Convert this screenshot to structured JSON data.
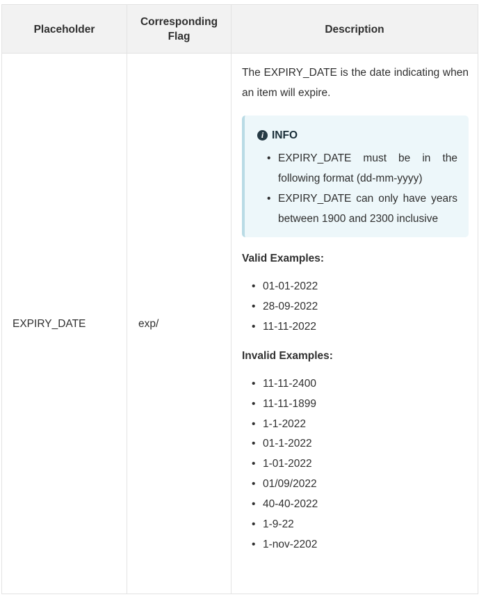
{
  "table": {
    "headers": {
      "placeholder": "Placeholder",
      "flag_line1": "Corresponding",
      "flag_line2": "Flag",
      "description": "Description"
    },
    "row": {
      "placeholder": "EXPIRY_DATE",
      "flag": "exp/",
      "description": {
        "intro": "The EXPIRY_DATE is the date indicating when an item will expire.",
        "info": {
          "icon": "info-circle-icon",
          "title": "INFO",
          "items": [
            "EXPIRY_DATE must be in the following format (dd-mm-yyyy)",
            "EXPIRY_DATE can only have years between 1900 and 2300 inclusive"
          ]
        },
        "valid_heading": "Valid Examples:",
        "valid_examples": [
          "01-01-2022",
          "28-09-2022",
          "11-11-2022"
        ],
        "invalid_heading": "Invalid Examples:",
        "invalid_examples": [
          "11-11-2400",
          "11-11-1899",
          "1-1-2022",
          "01-1-2022",
          "1-01-2022",
          "01/09/2022",
          "40-40-2022",
          "1-9-22",
          "1-nov-2202"
        ]
      }
    }
  },
  "colors": {
    "header_bg": "#f2f2f2",
    "border": "#e3e3e3",
    "info_bg": "#edf7fa",
    "info_border": "#b9dbe5",
    "text": "#2f2f2f"
  }
}
